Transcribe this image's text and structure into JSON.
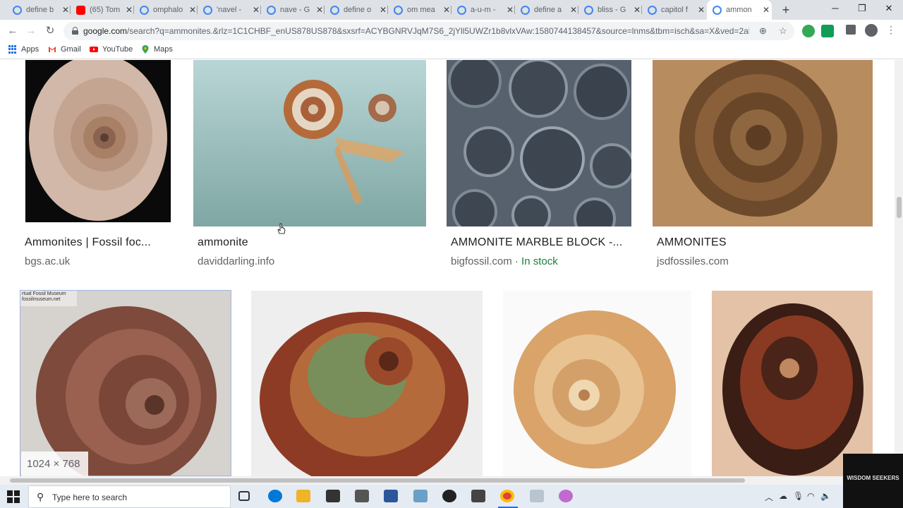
{
  "browser": {
    "tabs": [
      {
        "title": "define b",
        "favicon": "google-g"
      },
      {
        "title": "(65) Tom",
        "favicon": "youtube"
      },
      {
        "title": "omphalo",
        "favicon": "google-g"
      },
      {
        "title": "'navel -",
        "favicon": "google-g"
      },
      {
        "title": "nave - G",
        "favicon": "google-g"
      },
      {
        "title": "define o",
        "favicon": "google-g"
      },
      {
        "title": "om mea",
        "favicon": "google-g"
      },
      {
        "title": "a-u-m -",
        "favicon": "google-g"
      },
      {
        "title": "define a",
        "favicon": "google-g"
      },
      {
        "title": "bliss - G",
        "favicon": "google-g"
      },
      {
        "title": "capitol f",
        "favicon": "google-g"
      },
      {
        "title": "ammon",
        "favicon": "google-g",
        "active": true
      }
    ],
    "url_domain": "google.com",
    "url_rest": "/search?q=ammonites.&rlz=1C1CHBF_enUS878US878&sxsrf=ACYBGNRVJqM7S6_2jYll5UWZr1b8vlxVAw:1580744138457&source=lnms&tbm=isch&sa=X&ved=2ahUKEwj...",
    "bookmarks": [
      {
        "label": "Apps",
        "icon": "apps-grid-icon"
      },
      {
        "label": "Gmail",
        "icon": "gmail-icon"
      },
      {
        "label": "YouTube",
        "icon": "youtube-icon"
      },
      {
        "label": "Maps",
        "icon": "maps-icon"
      }
    ]
  },
  "results": {
    "row1": [
      {
        "title": "Ammonites | Fossil foc...",
        "source": "bgs.ac.uk",
        "stock": ""
      },
      {
        "title": "ammonite",
        "source": "daviddarling.info",
        "stock": ""
      },
      {
        "title": "AMMONITE MARBLE BLOCK -...",
        "source": "bigfossil.com",
        "stock": " · In stock"
      },
      {
        "title": "AMMONITES",
        "source": "jsdfossiles.com",
        "stock": ""
      }
    ],
    "row2_badge": "1024 × 768",
    "row2_overlay_text": "rtual Fossil Museum\nfossilmuseum.net"
  },
  "taskbar": {
    "search_placeholder": "Type here to search",
    "watermark": "WISDOM SEEKERS"
  },
  "colors": {
    "accent": "#1a73e8",
    "in_stock": "#188038"
  }
}
